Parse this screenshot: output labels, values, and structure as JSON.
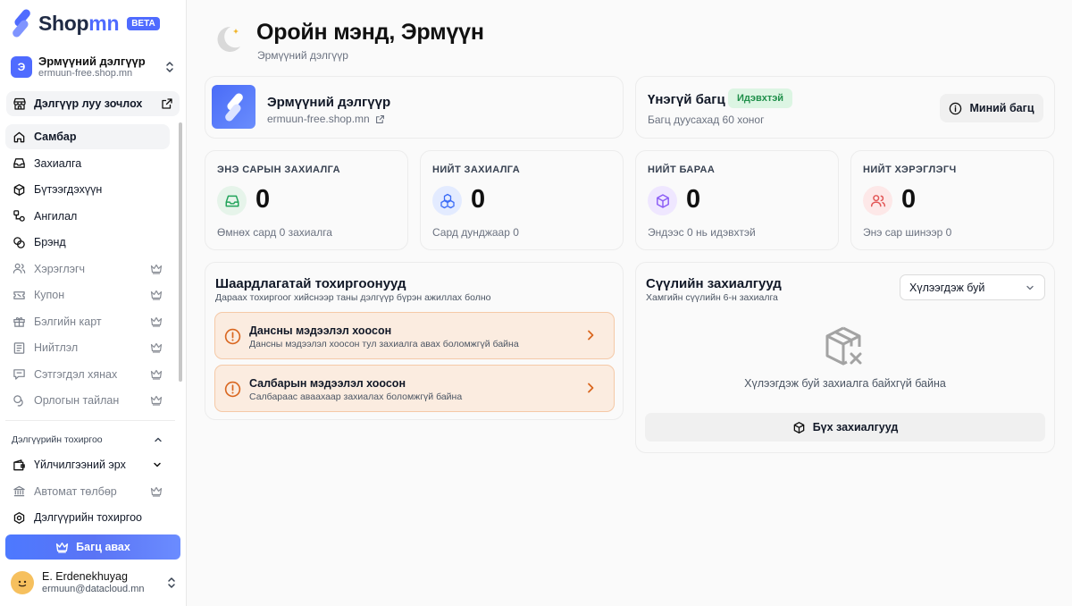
{
  "brand": {
    "name_part1": "Shop",
    "name_part2": "mn",
    "badge": "BETA"
  },
  "store": {
    "initial": "Э",
    "name": "Эрмүүний дэлгүүр",
    "url": "ermuun-free.shop.mn"
  },
  "sidebar": {
    "visit_store": "Дэлгүүр луу зочлох",
    "items": [
      {
        "label": "Самбар",
        "icon": "home-icon",
        "active": true,
        "locked": false
      },
      {
        "label": "Захиалга",
        "icon": "inbox-icon",
        "active": false,
        "locked": false
      },
      {
        "label": "Бүтээгдэхүүн",
        "icon": "box-icon",
        "active": false,
        "locked": false
      },
      {
        "label": "Ангилал",
        "icon": "category-icon",
        "active": false,
        "locked": false
      },
      {
        "label": "Брэнд",
        "icon": "brand-icon",
        "active": false,
        "locked": false
      },
      {
        "label": "Хэрэглэгч",
        "icon": "users-icon",
        "active": false,
        "locked": true
      },
      {
        "label": "Купон",
        "icon": "ticket-icon",
        "active": false,
        "locked": true
      },
      {
        "label": "Бэлгийн карт",
        "icon": "gift-icon",
        "active": false,
        "locked": true
      },
      {
        "label": "Нийтлэл",
        "icon": "article-icon",
        "active": false,
        "locked": true
      },
      {
        "label": "Сэтгэгдэл хянах",
        "icon": "review-icon",
        "active": false,
        "locked": true
      },
      {
        "label": "Орлогын тайлан",
        "icon": "coins-icon",
        "active": false,
        "locked": true
      }
    ],
    "settings_section": {
      "title": "Дэлгүүрийн тохиргоо",
      "items": [
        {
          "label": "Үйлчилгээний эрх",
          "icon": "wallet-icon"
        },
        {
          "label": "Автомат төлбөр",
          "icon": "bank-icon"
        },
        {
          "label": "Дэлгүүрийн тохиргоо",
          "icon": "settings-icon"
        }
      ]
    },
    "upgrade_label": "Багц авах"
  },
  "user": {
    "name": "E. Erdenekhuyag",
    "email": "ermuun@datacloud.mn"
  },
  "header": {
    "greeting": "Оройн мэнд, Эрмүүн",
    "subtitle": "Эрмүүний дэлгүүр"
  },
  "plan": {
    "title": "Үнэгүй багц",
    "status": "Идэвхтэй",
    "expires": "Багц дуусахад 60 хоног",
    "button": "Миний багц"
  },
  "stats": [
    {
      "label": "ЭНЭ САРЫН ЗАХИАЛГА",
      "value": "0",
      "sub": "Өмнөх сард 0 захиалга",
      "icon": "inbox-icon",
      "icon_bg": "#e6f4ea",
      "icon_color": "#22a35a"
    },
    {
      "label": "НИЙТ ЗАХИАЛГА",
      "value": "0",
      "sub": "Сард дунджаар 0",
      "icon": "boxes-icon",
      "icon_bg": "#e3ebff",
      "icon_color": "#3b6cf6"
    },
    {
      "label": "НИЙТ БАРАА",
      "value": "0",
      "sub": "Эндээс 0 нь идэвхтэй",
      "icon": "package-icon",
      "icon_bg": "#efe7ff",
      "icon_color": "#8b5cf6"
    },
    {
      "label": "НИЙТ ХЭРЭГЛЭГЧ",
      "value": "0",
      "sub": "Энэ сар шинээр 0",
      "icon": "users-icon",
      "icon_bg": "#fde8e8",
      "icon_color": "#e25555"
    }
  ],
  "requirements": {
    "title": "Шаардлагатай тохиргоонууд",
    "subtitle": "Дараах тохиргоог хийснээр таны дэлгүүр бүрэн ажиллах болно",
    "items": [
      {
        "title": "Дансны мэдээлэл хоосон",
        "desc": "Дансны мэдээлэл хоосон тул захиалга авах боломжгүй байна"
      },
      {
        "title": "Салбарын мэдээлэл хоосон",
        "desc": "Салбараас аваахаар захиалах боломжгүй байна"
      }
    ]
  },
  "recent_orders": {
    "title": "Сүүлийн захиалгууд",
    "subtitle": "Хамгийн сүүлийн 6-н захиалга",
    "filter_value": "Хүлээгдэж буй",
    "empty_text": "Хүлээгдэж буй захиалга байхгүй байна",
    "all_button": "Бүх захиалгууд"
  }
}
